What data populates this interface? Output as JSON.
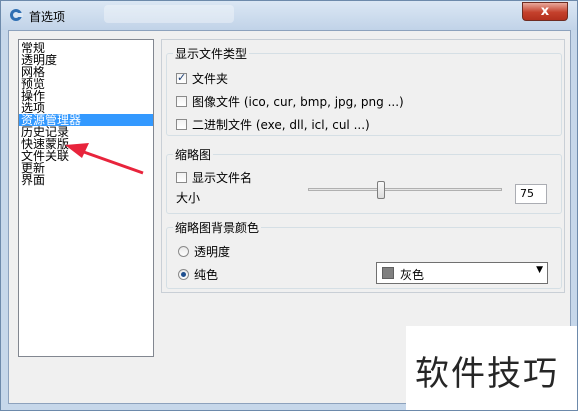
{
  "window": {
    "title": "首选项",
    "close_label": "x"
  },
  "nav": {
    "items": [
      "常规",
      "透明度",
      "网格",
      "预览",
      "操作",
      "选项",
      "资源管理器",
      "历史记录",
      "快速蒙版",
      "文件关联",
      "更新",
      "界面"
    ],
    "selected_index": 6
  },
  "file_types": {
    "title": "显示文件类型",
    "folders": {
      "label": "文件夹",
      "checked": true
    },
    "images": {
      "label": "图像文件 (ico, cur, bmp, jpg, png ...)",
      "checked": false
    },
    "binary": {
      "label": "二进制文件 (exe, dll, icl, cul ...)",
      "checked": false
    }
  },
  "thumbnail": {
    "title": "缩略图",
    "show_filename": {
      "label": "显示文件名",
      "checked": false
    },
    "size_label": "大小",
    "size_value": "75",
    "slider": {
      "min": 0,
      "max": 200,
      "value": 75
    }
  },
  "bg_color": {
    "title": "缩略图背景颜色",
    "transparency": {
      "label": "透明度",
      "selected": false
    },
    "solid": {
      "label": "纯色",
      "selected": true
    },
    "color_option": {
      "label": "灰色",
      "swatch": "#808080"
    }
  },
  "watermark": "软件技巧",
  "colors": {
    "selection": "#3399ff",
    "arrow": "#e8243c"
  }
}
